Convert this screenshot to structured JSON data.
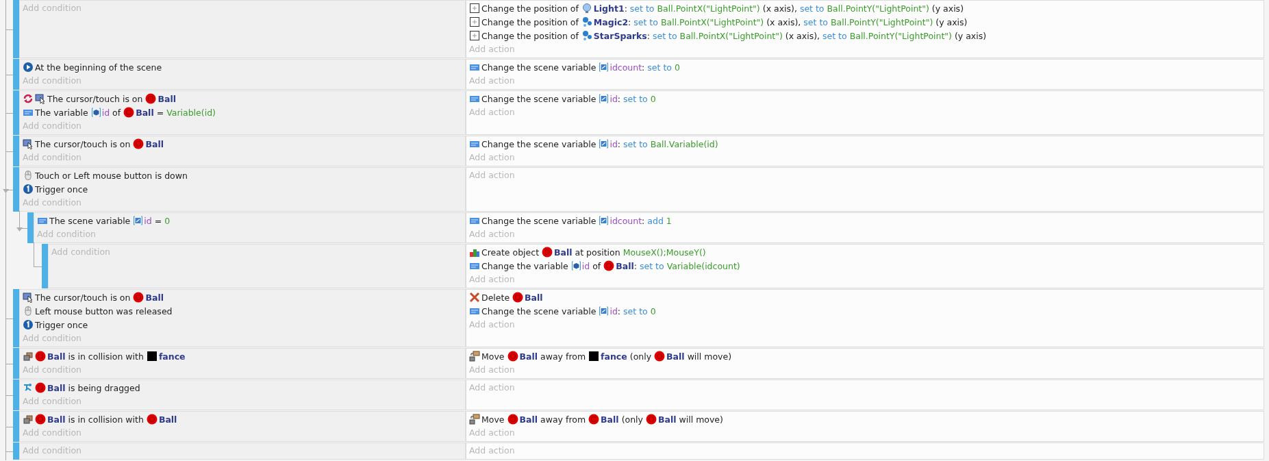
{
  "events": [
    {
      "add_condition": "Add condition",
      "actions": [
        {
          "kind": "position",
          "parts": [
            {
              "kind": "text",
              "text": "Change the position of"
            },
            {
              "kind": "light-object",
              "text": "Light1"
            },
            {
              "kind": "punct",
              "text": ":"
            },
            {
              "kind": "keyword",
              "text": "set to"
            },
            {
              "kind": "value",
              "text": "Ball.PointX(\"LightPoint\")"
            },
            {
              "kind": "text",
              "text": "(x axis),"
            },
            {
              "kind": "keyword",
              "text": "set to"
            },
            {
              "kind": "value",
              "text": "Ball.PointY(\"LightPoint\")"
            },
            {
              "kind": "text",
              "text": "(y axis)"
            }
          ]
        },
        {
          "kind": "position",
          "parts": [
            {
              "kind": "text",
              "text": "Change the position of"
            },
            {
              "kind": "particles-object",
              "text": "Magic2"
            },
            {
              "kind": "punct",
              "text": ":"
            },
            {
              "kind": "keyword",
              "text": "set to"
            },
            {
              "kind": "value",
              "text": "Ball.PointX(\"LightPoint\")"
            },
            {
              "kind": "text",
              "text": "(x axis),"
            },
            {
              "kind": "keyword",
              "text": "set to"
            },
            {
              "kind": "value",
              "text": "Ball.PointY(\"LightPoint\")"
            },
            {
              "kind": "text",
              "text": "(y axis)"
            }
          ]
        },
        {
          "kind": "position",
          "parts": [
            {
              "kind": "text",
              "text": "Change the position of"
            },
            {
              "kind": "particles-object",
              "text": "StarSparks"
            },
            {
              "kind": "punct",
              "text": ":"
            },
            {
              "kind": "keyword",
              "text": "set to"
            },
            {
              "kind": "value",
              "text": "Ball.PointX(\"LightPoint\")"
            },
            {
              "kind": "text",
              "text": "(x axis),"
            },
            {
              "kind": "keyword",
              "text": "set to"
            },
            {
              "kind": "value",
              "text": "Ball.PointY(\"LightPoint\")"
            },
            {
              "kind": "text",
              "text": "(y axis)"
            }
          ]
        }
      ],
      "add_action": "Add action"
    },
    {
      "conditions": [
        {
          "kind": "start",
          "inverted": false,
          "parts": [
            {
              "kind": "text",
              "text": "At the beginning of the scene"
            }
          ]
        }
      ],
      "add_condition": "Add condition",
      "actions": [
        {
          "kind": "variable",
          "parts": [
            {
              "kind": "text",
              "text": "Change the scene variable"
            },
            {
              "kind": "scene-variable",
              "text": "idcount"
            },
            {
              "kind": "punct",
              "text": ":"
            },
            {
              "kind": "keyword",
              "text": "set to"
            },
            {
              "kind": "value",
              "text": "0"
            }
          ]
        }
      ],
      "add_action": "Add action"
    },
    {
      "conditions": [
        {
          "kind": "cursor",
          "inverted": true,
          "parts": [
            {
              "kind": "text",
              "text": "The cursor/touch is on"
            },
            {
              "kind": "ball-object",
              "text": "Ball"
            }
          ]
        },
        {
          "kind": "variable",
          "inverted": false,
          "parts": [
            {
              "kind": "text",
              "text": "The variable"
            },
            {
              "kind": "object-variable",
              "text": "id"
            },
            {
              "kind": "text",
              "text": "of"
            },
            {
              "kind": "ball-object",
              "text": "Ball"
            },
            {
              "kind": "text",
              "text": "="
            },
            {
              "kind": "value",
              "text": "Variable(id)"
            }
          ]
        }
      ],
      "add_condition": "Add condition",
      "actions": [
        {
          "kind": "variable",
          "parts": [
            {
              "kind": "text",
              "text": "Change the scene variable"
            },
            {
              "kind": "scene-variable",
              "text": "id"
            },
            {
              "kind": "punct",
              "text": ":"
            },
            {
              "kind": "keyword",
              "text": "set to"
            },
            {
              "kind": "value",
              "text": "0"
            }
          ]
        }
      ],
      "add_action": "Add action"
    },
    {
      "conditions": [
        {
          "kind": "cursor",
          "inverted": false,
          "parts": [
            {
              "kind": "text",
              "text": "The cursor/touch is on"
            },
            {
              "kind": "ball-object",
              "text": "Ball"
            }
          ]
        }
      ],
      "add_condition": "Add condition",
      "actions": [
        {
          "kind": "variable",
          "parts": [
            {
              "kind": "text",
              "text": "Change the scene variable"
            },
            {
              "kind": "scene-variable",
              "text": "id"
            },
            {
              "kind": "punct",
              "text": ":"
            },
            {
              "kind": "keyword",
              "text": "set to"
            },
            {
              "kind": "value",
              "text": "Ball.Variable(id)"
            }
          ]
        }
      ],
      "add_action": "Add action"
    },
    {
      "conditions": [
        {
          "kind": "mouse",
          "inverted": false,
          "parts": [
            {
              "kind": "text",
              "text": "Touch or Left mouse button is down"
            }
          ]
        },
        {
          "kind": "trigger",
          "inverted": false,
          "parts": [
            {
              "kind": "text",
              "text": "Trigger once"
            }
          ]
        }
      ],
      "add_condition": "Add condition",
      "add_action": "Add action",
      "children": [
        {
          "conditions": [
            {
              "kind": "variable",
              "inverted": false,
              "parts": [
                {
                  "kind": "text",
                  "text": "The scene variable"
                },
                {
                  "kind": "scene-variable",
                  "text": "id"
                },
                {
                  "kind": "text",
                  "text": "="
                },
                {
                  "kind": "value",
                  "text": "0"
                }
              ]
            }
          ],
          "add_condition": "Add condition",
          "actions": [
            {
              "kind": "variable",
              "parts": [
                {
                  "kind": "text",
                  "text": "Change the scene variable"
                },
                {
                  "kind": "scene-variable",
                  "text": "idcount"
                },
                {
                  "kind": "punct",
                  "text": ":"
                },
                {
                  "kind": "keyword",
                  "text": "add"
                },
                {
                  "kind": "value",
                  "text": "1"
                }
              ]
            }
          ],
          "add_action": "Add action",
          "children": [
            {
              "add_condition": "Add condition",
              "actions": [
                {
                  "kind": "create",
                  "parts": [
                    {
                      "kind": "text",
                      "text": "Create object"
                    },
                    {
                      "kind": "ball-object",
                      "text": "Ball"
                    },
                    {
                      "kind": "text",
                      "text": "at position"
                    },
                    {
                      "kind": "value",
                      "text": "MouseX();MouseY()"
                    }
                  ]
                },
                {
                  "kind": "variable",
                  "parts": [
                    {
                      "kind": "text",
                      "text": "Change the variable"
                    },
                    {
                      "kind": "object-variable",
                      "text": "id"
                    },
                    {
                      "kind": "text",
                      "text": "of"
                    },
                    {
                      "kind": "ball-object",
                      "text": "Ball"
                    },
                    {
                      "kind": "punct",
                      "text": ":"
                    },
                    {
                      "kind": "keyword",
                      "text": "set to"
                    },
                    {
                      "kind": "value",
                      "text": "Variable(idcount)"
                    }
                  ]
                }
              ],
              "add_action": "Add action"
            }
          ]
        }
      ]
    },
    {
      "conditions": [
        {
          "kind": "cursor",
          "inverted": false,
          "parts": [
            {
              "kind": "text",
              "text": "The cursor/touch is on"
            },
            {
              "kind": "ball-object",
              "text": "Ball"
            }
          ]
        },
        {
          "kind": "mouse",
          "inverted": false,
          "parts": [
            {
              "kind": "text",
              "text": "Left mouse button was released"
            }
          ]
        },
        {
          "kind": "trigger",
          "inverted": false,
          "parts": [
            {
              "kind": "text",
              "text": "Trigger once"
            }
          ]
        }
      ],
      "add_condition": "Add condition",
      "actions": [
        {
          "kind": "delete",
          "parts": [
            {
              "kind": "text",
              "text": "Delete"
            },
            {
              "kind": "ball-object",
              "text": "Ball"
            }
          ]
        },
        {
          "kind": "variable",
          "parts": [
            {
              "kind": "text",
              "text": "Change the scene variable"
            },
            {
              "kind": "scene-variable",
              "text": "id"
            },
            {
              "kind": "punct",
              "text": ":"
            },
            {
              "kind": "keyword",
              "text": "set to"
            },
            {
              "kind": "value",
              "text": "0"
            }
          ]
        }
      ],
      "add_action": "Add action"
    },
    {
      "conditions": [
        {
          "kind": "collision",
          "inverted": false,
          "parts": [
            {
              "kind": "ball-object",
              "text": "Ball"
            },
            {
              "kind": "text",
              "text": "is in collision with"
            },
            {
              "kind": "square-object",
              "text": "fance"
            }
          ]
        }
      ],
      "add_condition": "Add condition",
      "actions": [
        {
          "kind": "separate",
          "parts": [
            {
              "kind": "text",
              "text": "Move"
            },
            {
              "kind": "ball-object",
              "text": "Ball"
            },
            {
              "kind": "text",
              "text": "away from"
            },
            {
              "kind": "square-object",
              "text": "fance"
            },
            {
              "kind": "text",
              "text": "(only"
            },
            {
              "kind": "ball-object",
              "text": "Ball"
            },
            {
              "kind": "text",
              "text": "will move)"
            }
          ]
        }
      ],
      "add_action": "Add action"
    },
    {
      "conditions": [
        {
          "kind": "drag",
          "inverted": false,
          "parts": [
            {
              "kind": "ball-object",
              "text": "Ball"
            },
            {
              "kind": "text",
              "text": "is being dragged"
            }
          ]
        }
      ],
      "add_condition": "Add condition",
      "add_action": "Add action"
    },
    {
      "conditions": [
        {
          "kind": "collision",
          "inverted": false,
          "parts": [
            {
              "kind": "ball-object",
              "text": "Ball"
            },
            {
              "kind": "text",
              "text": "is in collision with"
            },
            {
              "kind": "ball-object",
              "text": "Ball"
            }
          ]
        }
      ],
      "add_condition": "Add condition",
      "actions": [
        {
          "kind": "separate",
          "parts": [
            {
              "kind": "text",
              "text": "Move"
            },
            {
              "kind": "ball-object",
              "text": "Ball"
            },
            {
              "kind": "text",
              "text": "away from"
            },
            {
              "kind": "ball-object",
              "text": "Ball"
            },
            {
              "kind": "text",
              "text": "(only"
            },
            {
              "kind": "ball-object",
              "text": "Ball"
            },
            {
              "kind": "text",
              "text": "will move)"
            }
          ]
        }
      ],
      "add_action": "Add action"
    },
    {
      "add_condition": "Add condition",
      "add_action": "Add action"
    }
  ]
}
